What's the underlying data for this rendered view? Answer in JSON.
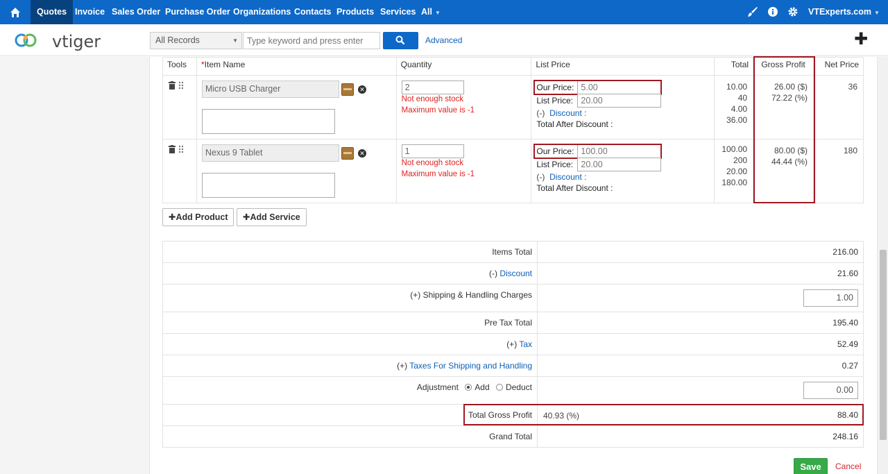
{
  "topnav": {
    "items": [
      "Quotes",
      "Invoice",
      "Sales Order",
      "Purchase Order",
      "Organizations",
      "Contacts",
      "Products",
      "Services",
      "All"
    ],
    "active": "Quotes",
    "user": "VTExperts.com",
    "icons": [
      "home-icon",
      "paint-brush-icon",
      "info-icon",
      "gear-icon"
    ]
  },
  "header": {
    "logo": "vtiger",
    "record_select": "All Records",
    "search_placeholder": "Type keyword and press enter",
    "advanced": "Advanced"
  },
  "items_table": {
    "columns": [
      "Tools",
      "Item Name",
      "Quantity",
      "List Price",
      "Total",
      "Gross Profit",
      "Net Price"
    ],
    "rows": [
      {
        "item": "Micro USB Charger",
        "quantity": "2",
        "warn1": "Not enough stock",
        "warn2": "Maximum value is -1",
        "our_price_label": "Our Price:",
        "our_price": "5.00",
        "list_price_label": "List Price:",
        "list_price": "20.00",
        "discount_prefix": "(-)",
        "discount_label": "Discount",
        "total_after_discount": "Total After Discount :",
        "totals": [
          "10.00",
          "40",
          "4.00",
          "36.00"
        ],
        "gp_amount": "26.00 ($)",
        "gp_percent": "72.22 (%)",
        "net_price": "36"
      },
      {
        "item": "Nexus 9 Tablet",
        "quantity": "1",
        "warn1": "Not enough stock",
        "warn2": "Maximum value is -1",
        "our_price_label": "Our Price:",
        "our_price": "100.00",
        "list_price_label": "List Price:",
        "list_price": "20.00",
        "discount_prefix": "(-)",
        "discount_label": "Discount",
        "total_after_discount": "Total After Discount :",
        "totals": [
          "100.00",
          "200",
          "20.00",
          "180.00"
        ],
        "gp_amount": "80.00 ($)",
        "gp_percent": "44.44 (%)",
        "net_price": "180"
      }
    ]
  },
  "buttons": {
    "add_product": "Add Product",
    "add_service": "Add Service",
    "save": "Save",
    "cancel": "Cancel"
  },
  "summary": {
    "items_total_label": "Items Total",
    "items_total": "216.00",
    "discount_prefix": "(-)",
    "discount_label": "Discount",
    "discount": "21.60",
    "shipping_prefix": "(+)",
    "shipping_label": "Shipping & Handling Charges",
    "shipping": "1.00",
    "pre_tax_label": "Pre Tax Total",
    "pre_tax": "195.40",
    "tax_prefix": "(+)",
    "tax_label": "Tax",
    "tax": "52.49",
    "tax_ship_prefix": "(+)",
    "tax_ship_label": "Taxes For Shipping and Handling",
    "tax_ship": "0.27",
    "adjustment_label": "Adjustment",
    "adj_add": "Add",
    "adj_deduct": "Deduct",
    "adjustment": "0.00",
    "tgp_label": "Total Gross Profit",
    "tgp_percent": "40.93 (%)",
    "tgp": "88.40",
    "grand_label": "Grand Total",
    "grand": "248.16"
  },
  "colors": {
    "nav_blue": "#0d68c8",
    "active_tab": "#07427f",
    "highlight_red": "#a01820",
    "save_green": "#35aa47",
    "warning_red": "#e02020"
  }
}
